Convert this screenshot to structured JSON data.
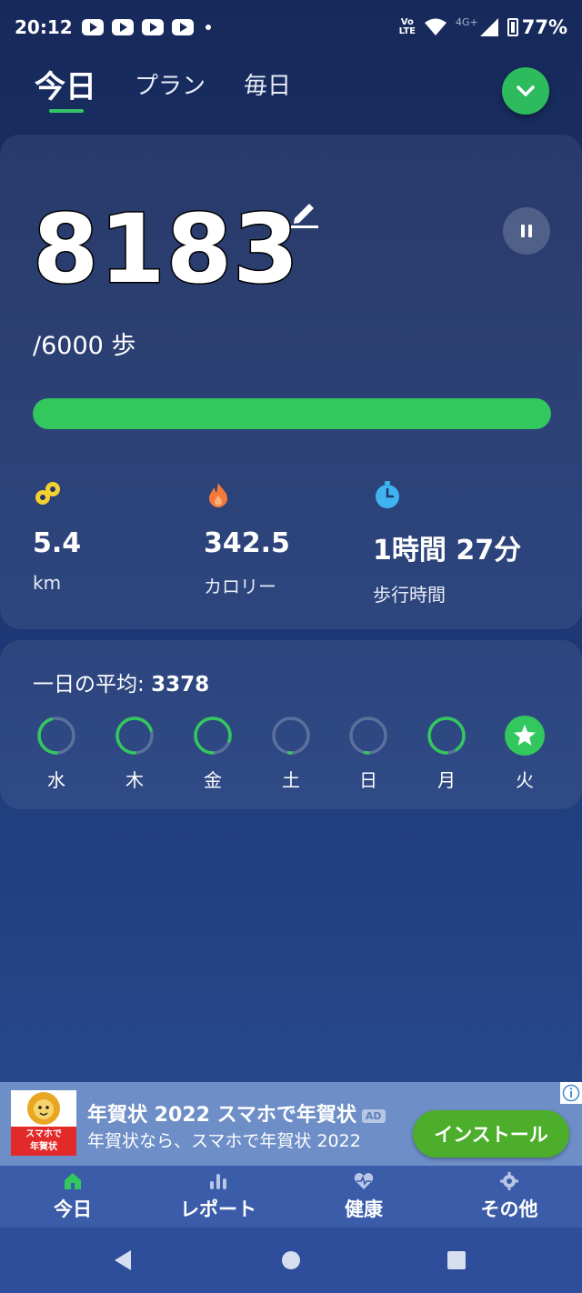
{
  "status_bar": {
    "time": "20:12",
    "network": "4G+",
    "lte_top": "Vo",
    "lte_bottom": "LTE",
    "battery": "77%"
  },
  "tabs": [
    {
      "label": "今日",
      "active": true
    },
    {
      "label": "プラン",
      "active": false
    },
    {
      "label": "毎日",
      "active": false
    }
  ],
  "today": {
    "steps": "8183",
    "goal_text": "/6000 歩",
    "progress_fraction": 1.0,
    "stats": [
      {
        "icon": "distance-icon",
        "value": "5.4",
        "label": "km"
      },
      {
        "icon": "flame-icon",
        "value": "342.5",
        "label": "カロリー"
      },
      {
        "icon": "stopwatch-icon",
        "value": "1時間 27分",
        "label": "歩行時間"
      }
    ]
  },
  "average": {
    "label": "一日の平均: ",
    "value": "3378",
    "days": [
      {
        "label": "水",
        "fraction": 0.45,
        "star": false
      },
      {
        "label": "木",
        "fraction": 0.7,
        "star": false
      },
      {
        "label": "金",
        "fraction": 0.8,
        "star": false
      },
      {
        "label": "土",
        "fraction": 0.02,
        "star": false
      },
      {
        "label": "日",
        "fraction": 0.03,
        "star": false
      },
      {
        "label": "月",
        "fraction": 0.9,
        "star": false
      },
      {
        "label": "火",
        "fraction": 1.0,
        "star": true
      }
    ]
  },
  "ad": {
    "title": "年賀状 2022 スマホで年賀状",
    "badge": "AD",
    "description": "年賀状なら、スマホで年賀状 2022",
    "install_label": "インストール",
    "logo_line1": "スマホで",
    "logo_line2": "年賀状"
  },
  "bottom_nav": [
    {
      "icon": "home-icon",
      "label": "今日",
      "active": true
    },
    {
      "icon": "bar-chart-icon",
      "label": "レポート",
      "active": false
    },
    {
      "icon": "heart-pulse-icon",
      "label": "健康",
      "active": false
    },
    {
      "icon": "gear-icon",
      "label": "その他",
      "active": false
    }
  ],
  "colors": {
    "accent_green": "#33c85e",
    "background_top": "#17295a",
    "background_bottom": "#2a4f96",
    "distance_icon": "#f5d130",
    "flame_icon": "#f47a3a",
    "stopwatch_icon": "#3fb3f0"
  }
}
